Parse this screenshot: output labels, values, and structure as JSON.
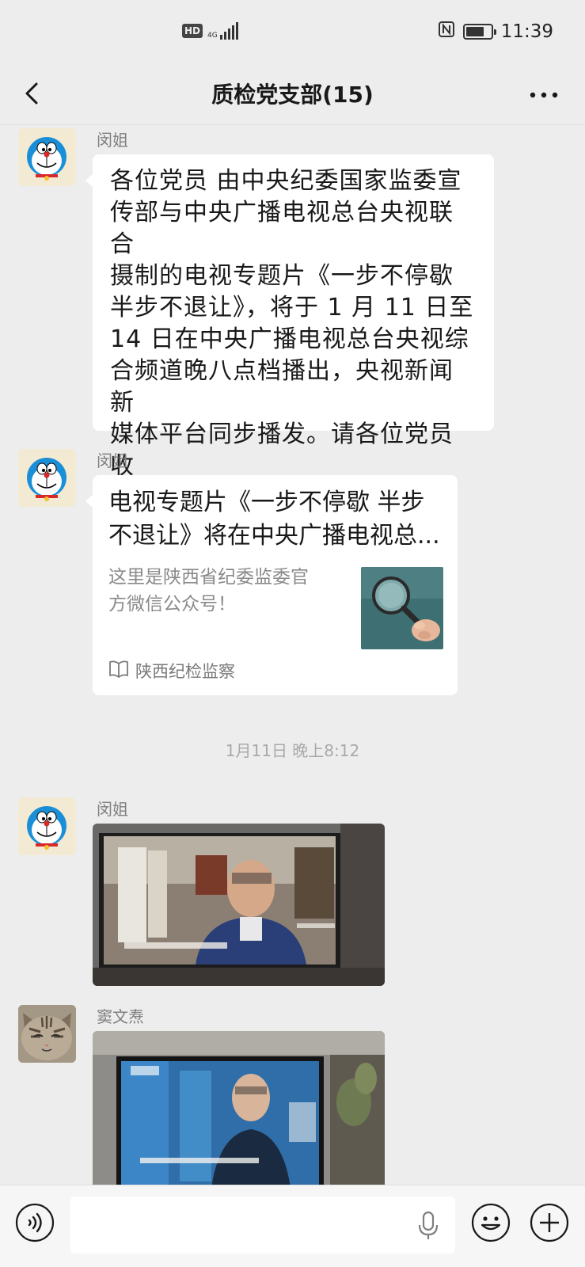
{
  "status_bar": {
    "hd": "HD",
    "network": "4G",
    "time": "11:39",
    "battery_level": 0.75
  },
  "header": {
    "title": "质检党支部(15)",
    "back_icon": "chevron-left-icon",
    "more_icon": "more-dots-icon"
  },
  "messages": [
    {
      "sender": "闵姐",
      "avatar": "doraemon-avatar",
      "text": "各位党员 由中央纪委国家监委宣\n传部与中央广播电视总台央视联合\n摄制的电视专题片《一步不停歇\n半步不退让》，将于 1 月 11 日至\n14 日在中央广播电视总台央视综\n合频道晚八点档播出，央视新闻新\n媒体平台同步播发。请各位党员收\n看！"
    },
    {
      "sender": "闵姐",
      "avatar": "doraemon-avatar",
      "card_title": "电视专题片《一步不停歇 半步\n不退让》将在中央广播电视总...",
      "card_desc": "这里是陕西省纪委监委官\n方微信公众号！",
      "card_source": "陕西纪检监察",
      "card_thumb": "magnifying-glass-image"
    },
    {
      "timestamp": "1月11日 晚上8:12"
    },
    {
      "sender": "闵姐",
      "avatar": "doraemon-avatar",
      "photo": "tv-screen-photo"
    },
    {
      "sender": "窦文焘",
      "avatar": "cat-avatar",
      "photo": "tv-screen-photo"
    }
  ],
  "input_bar": {
    "voice_icon": "voice-icon",
    "mic_icon": "microphone-icon",
    "emoji_icon": "emoji-icon",
    "plus_icon": "plus-icon",
    "placeholder": ""
  },
  "colors": {
    "background": "#ededed",
    "bubble": "#ffffff",
    "sender_name": "#7f7f7f",
    "timestamp": "#a9a9a9"
  }
}
